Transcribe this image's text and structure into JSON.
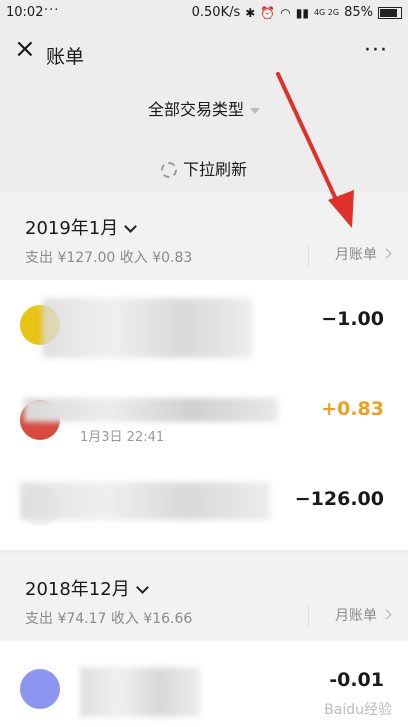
{
  "status": {
    "time": "10:02",
    "dots": "···",
    "speed": "0.50K/s",
    "signal": "4G 2G",
    "battery": "85%"
  },
  "nav": {
    "title": "账单",
    "more": "···"
  },
  "filter": {
    "label": "全部交易类型"
  },
  "refresh": {
    "label": "下拉刷新"
  },
  "months": [
    {
      "title": "2019年1月",
      "summary": "支出 ¥127.00 收入 ¥0.83",
      "bill_link": "月账单"
    },
    {
      "title": "2018年12月",
      "summary": "支出 ¥74.17 收入 ¥16.66",
      "bill_link": "月账单"
    }
  ],
  "transactions": [
    {
      "amount": "−1.00",
      "color": "#1a1a1a",
      "date": ""
    },
    {
      "amount": "+0.83",
      "color": "#f0a020",
      "date": "1月3日 22:41"
    },
    {
      "amount": "−126.00",
      "color": "#1a1a1a",
      "date": ""
    },
    {
      "amount": "-0.01",
      "color": "#1a1a1a",
      "date": ""
    }
  ],
  "accent_colors": {
    "income": "#f0a020",
    "arrow": "#e0302a"
  },
  "watermark": "Baidu经验"
}
